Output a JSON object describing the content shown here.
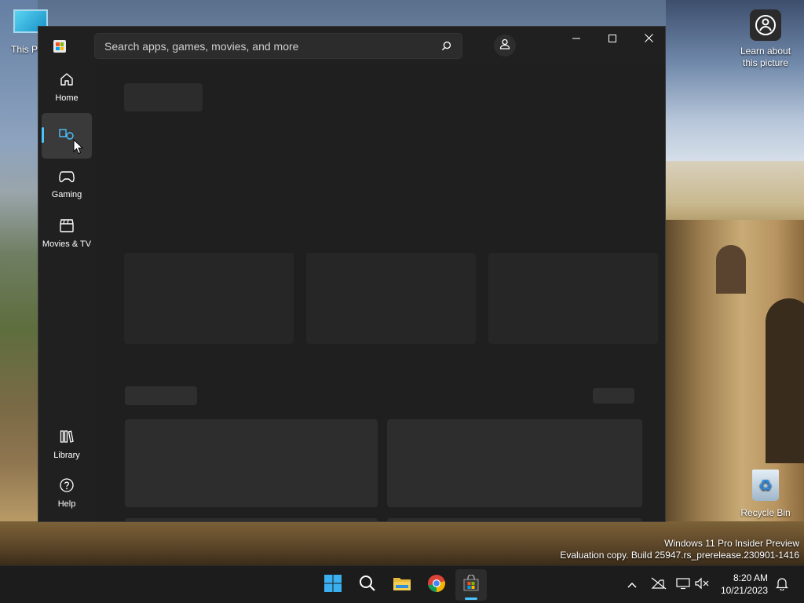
{
  "desktop": {
    "this_pc_label": "This PC",
    "learn_label": "Learn about this picture",
    "recycle_bin_label": "Recycle Bin",
    "watermark_line1": "Windows 11 Pro Insider Preview",
    "watermark_line2": "Evaluation copy. Build 25947.rs_prerelease.230901-1416"
  },
  "store": {
    "search_placeholder": "Search apps, games, movies, and more",
    "icons": {
      "search": "search-icon",
      "account": "account-icon",
      "minimize": "minimize-icon",
      "maximize": "maximize-icon",
      "close": "close-icon"
    },
    "nav": [
      {
        "label": "Home",
        "icon": "home-icon"
      },
      {
        "label": "",
        "icon": "apps-icon",
        "active": true
      },
      {
        "label": "Gaming",
        "icon": "gamepad-icon"
      },
      {
        "label": "Movies & TV",
        "icon": "clapperboard-icon"
      }
    ],
    "nav_bottom": [
      {
        "label": "Library",
        "icon": "library-icon"
      },
      {
        "label": "Help",
        "icon": "help-icon"
      }
    ],
    "content_state": "loading-skeleton",
    "accent_color": "#4cc2ff"
  },
  "taskbar": {
    "apps": [
      "start-icon",
      "search-icon",
      "file-explorer-icon",
      "chrome-icon",
      "microsoft-store-icon"
    ],
    "active_app": "microsoft-store-icon",
    "tray": [
      "chevron-up-icon",
      "network-icon",
      "display-icon",
      "volume-muted-icon",
      "notification-bell-icon"
    ],
    "time": "8:20 AM",
    "date": "10/21/2023"
  }
}
